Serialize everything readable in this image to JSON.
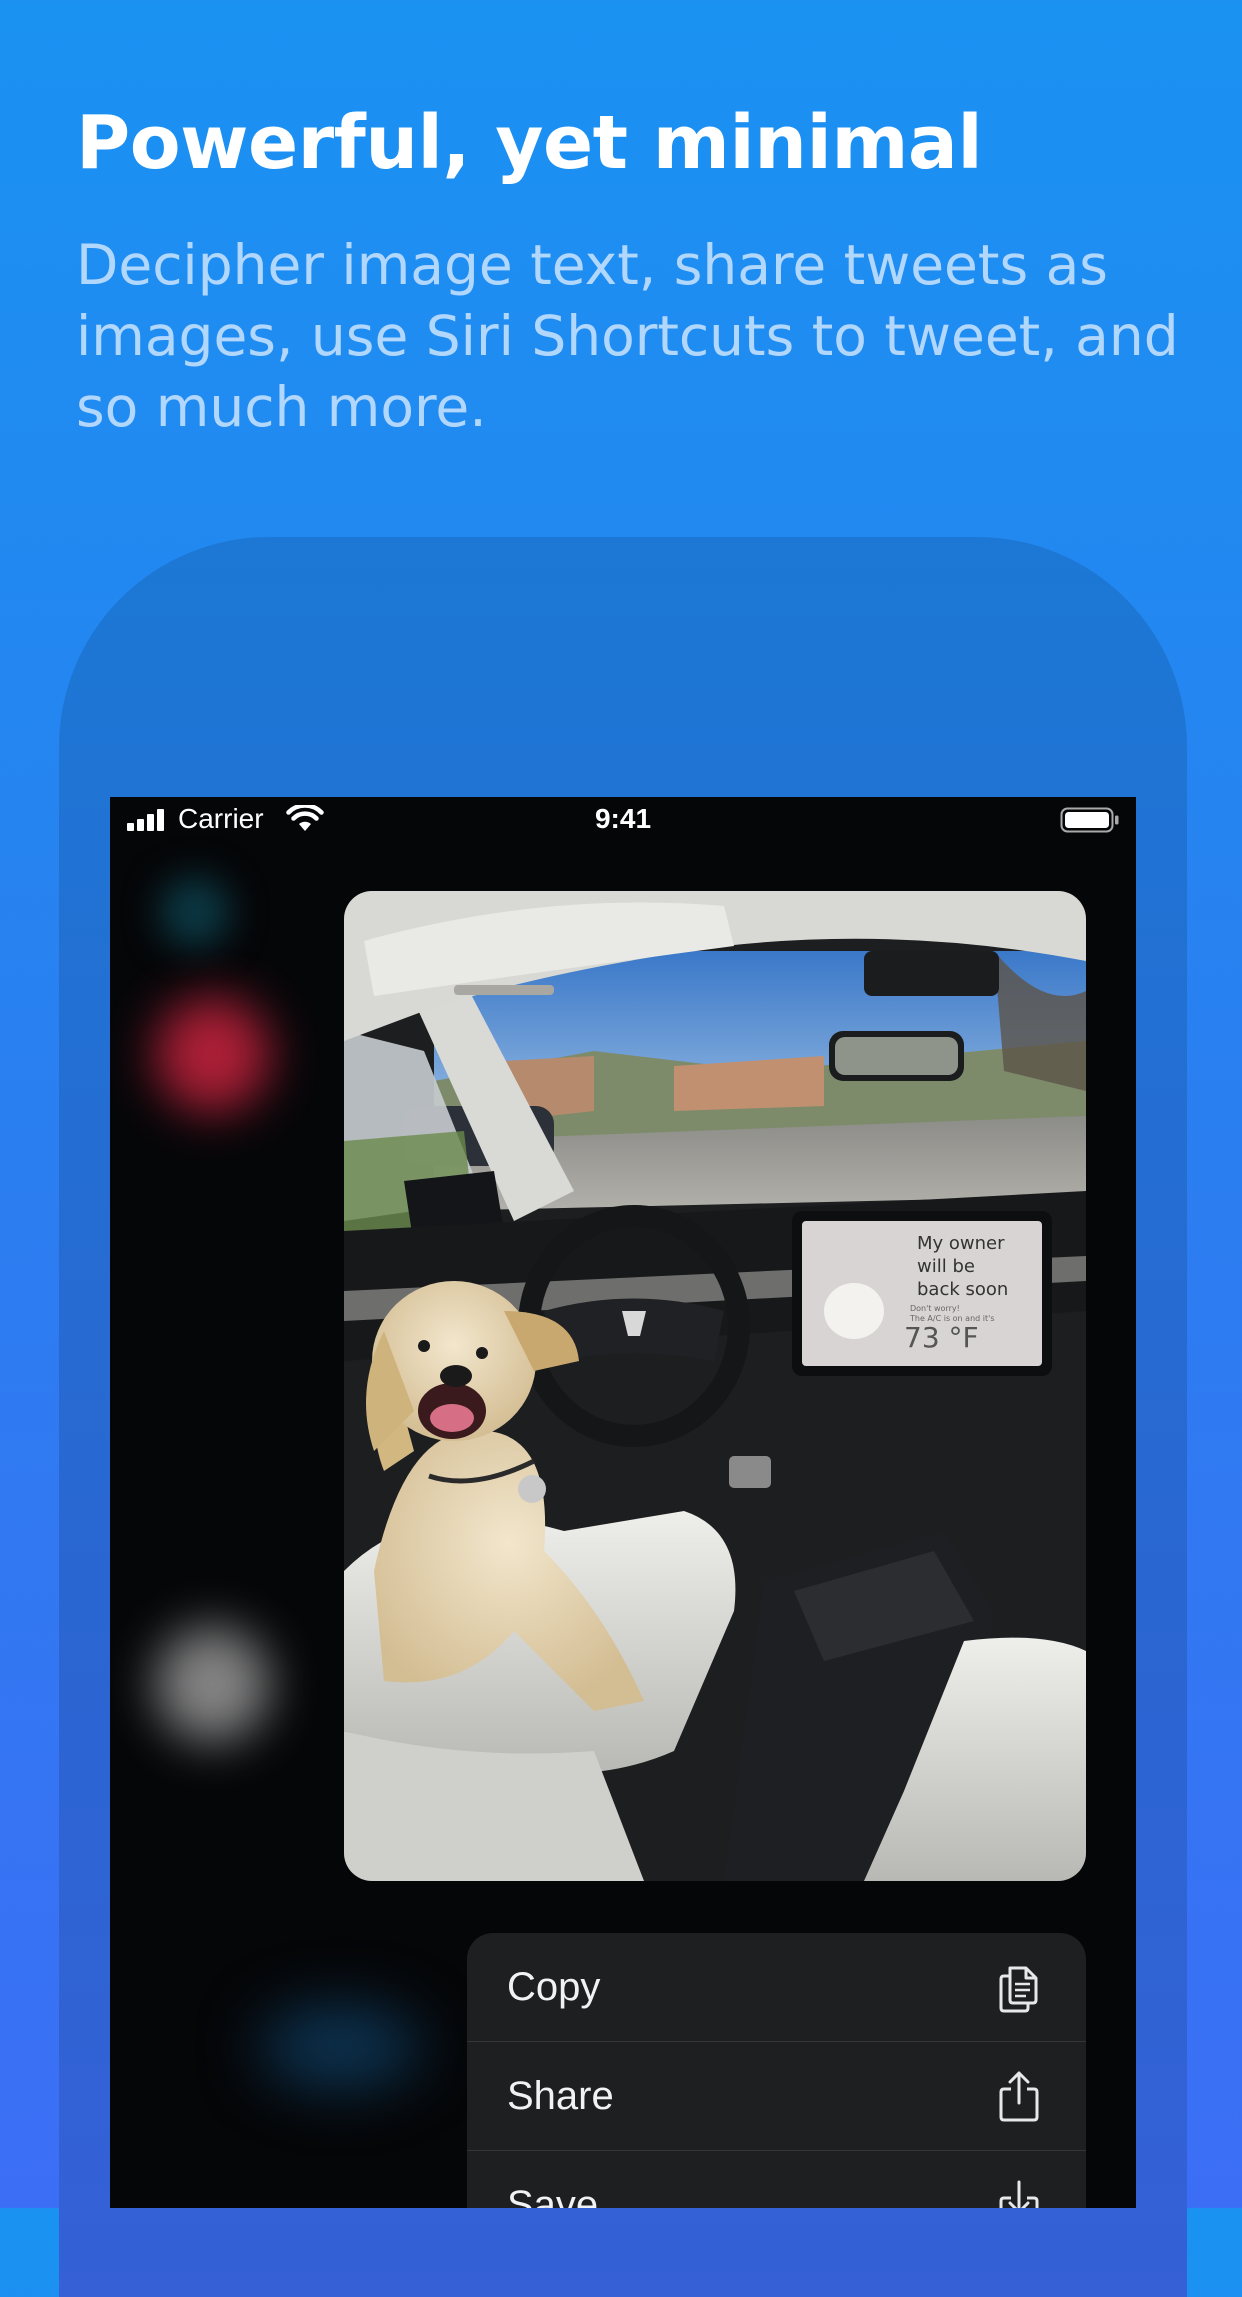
{
  "headline": "Powerful, yet minimal",
  "subheadline": "Decipher image text, share tweets as images, use Siri Shortcuts to tweet, and so much more.",
  "status_bar": {
    "carrier": "Carrier",
    "time": "9:41"
  },
  "photo": {
    "screen_text": {
      "line1": "My owner",
      "line2": "will be",
      "line3": "back soon",
      "small1": "Don't worry!",
      "small2": "The A/C is on and it's",
      "temperature": "73 °F"
    }
  },
  "context_menu": {
    "items": [
      {
        "label": "Copy",
        "icon": "copy-icon"
      },
      {
        "label": "Share",
        "icon": "share-icon"
      },
      {
        "label": "Save",
        "icon": "save-icon"
      }
    ]
  },
  "colors": {
    "background_top": "#1a92f2",
    "background_bottom": "#3c6ef5",
    "device_frame": "#1c78d4",
    "screen": "#050608",
    "menu": "#1e1f21"
  }
}
